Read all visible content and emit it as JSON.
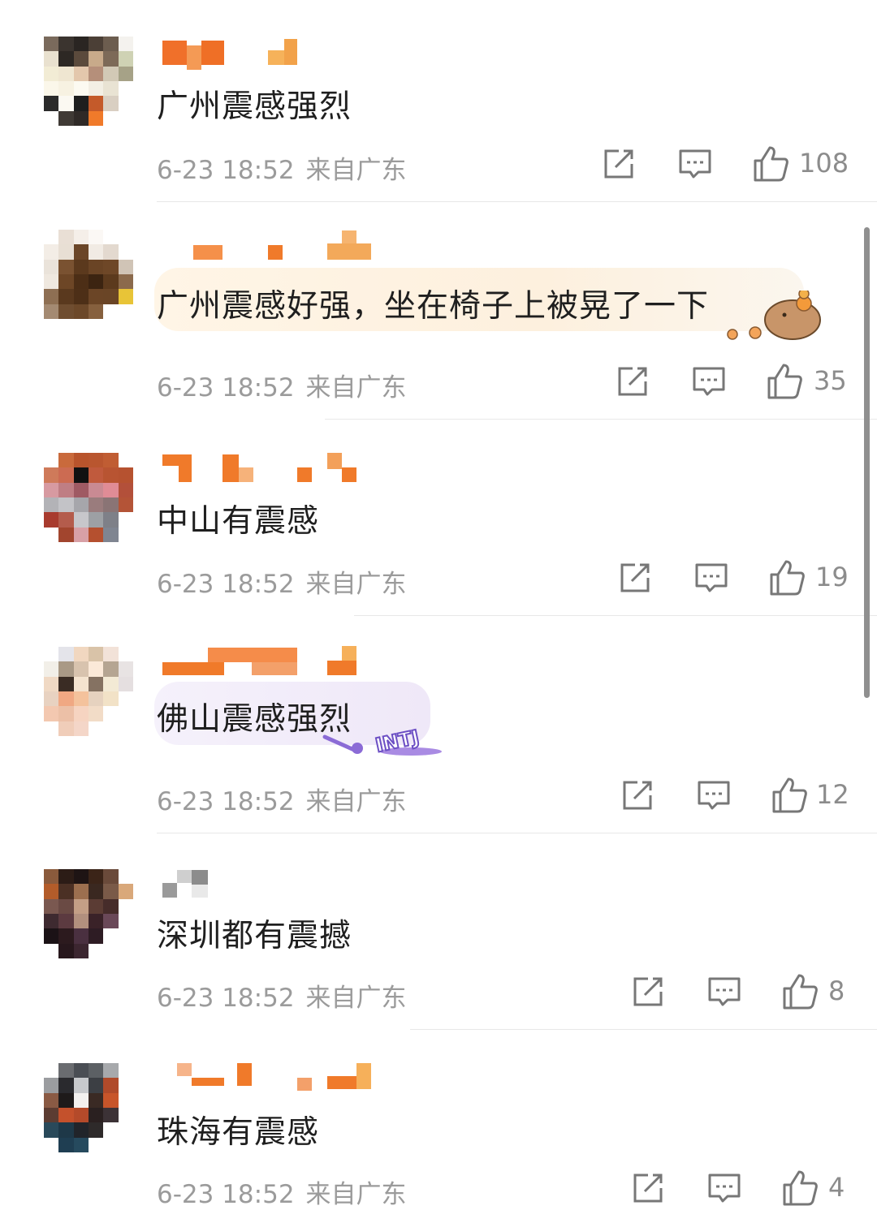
{
  "comments": [
    {
      "text": "广州震感强烈",
      "time": "6-23 18:52",
      "source": "来自广东",
      "likes": "108"
    },
    {
      "text": "广州震感好强，坐在椅子上被晃了一下",
      "time": "6-23 18:52",
      "source": "来自广东",
      "likes": "35"
    },
    {
      "text": "中山有震感",
      "time": "6-23 18:52",
      "source": "来自广东",
      "likes": "19"
    },
    {
      "text": "佛山震感强烈",
      "time": "6-23 18:52",
      "source": "来自广东",
      "likes": "12"
    },
    {
      "text": "深圳都有震撼",
      "time": "6-23 18:52",
      "source": "来自广东",
      "likes": "8"
    },
    {
      "text": "珠海有震感",
      "time": "6-23 18:52",
      "source": "来自广东",
      "likes": "4"
    }
  ],
  "icons": {
    "repost": "repost-icon",
    "comment": "comment-icon",
    "like": "like-icon"
  },
  "colors": {
    "username_mosaic": "#f0802a",
    "meta_text": "#9b9b9b",
    "body_text": "#1f1f1f"
  }
}
